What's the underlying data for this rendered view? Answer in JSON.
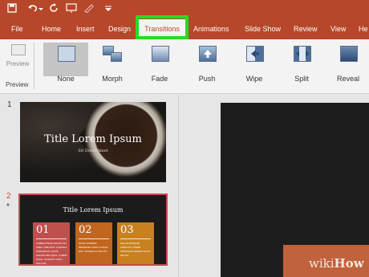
{
  "qat": {
    "icons": [
      "save-icon",
      "undo-icon",
      "redo-icon",
      "present-icon",
      "pen-icon",
      "customize-icon"
    ]
  },
  "tabs": [
    {
      "label": "File"
    },
    {
      "label": "Home"
    },
    {
      "label": "Insert"
    },
    {
      "label": "Design"
    },
    {
      "label": "Transitions",
      "active": true
    },
    {
      "label": "Animations"
    },
    {
      "label": "Slide Show"
    },
    {
      "label": "Review"
    },
    {
      "label": "View"
    },
    {
      "label": "He"
    }
  ],
  "ribbon": {
    "preview_label": "Preview",
    "group_label": "Preview",
    "transitions": [
      {
        "label": "None",
        "selected": true
      },
      {
        "label": "Morph"
      },
      {
        "label": "Fade"
      },
      {
        "label": "Push"
      },
      {
        "label": "Wipe"
      },
      {
        "label": "Split"
      },
      {
        "label": "Reveal"
      }
    ]
  },
  "slides": [
    {
      "number": "1",
      "title": "Title Lorem Ipsum",
      "subtitle": "Sit Dolor Amet"
    },
    {
      "number": "2",
      "star": "*",
      "title": "Title Lorem Ipsum",
      "boxes": [
        {
          "num": "01",
          "text": "LOREM IPSUM DOLOR SIT AMET, NIBH EST. A MAGNA MAECENAS, QUAM MAGNA NEC QUIS, LOREM NUNC. SUSCIPIT ODIO NULLAM.",
          "color": "#c0504d"
        },
        {
          "num": "02",
          "text": "NUNC VIVERRA IMPERDIET ENIM. FUSCE EST. VIVAMUS A TELLUS.",
          "color": "#c0661f"
        },
        {
          "num": "03",
          "text": "PELLENTESQUE HABITANT MORBI TRISTIQUE SENECTUS ET NETUS.",
          "color": "#c7811e"
        }
      ]
    }
  ],
  "watermark": {
    "part1": "wiki",
    "part2": "How"
  },
  "colors": {
    "accent": "#b7472a",
    "highlight": "#22dd22"
  }
}
